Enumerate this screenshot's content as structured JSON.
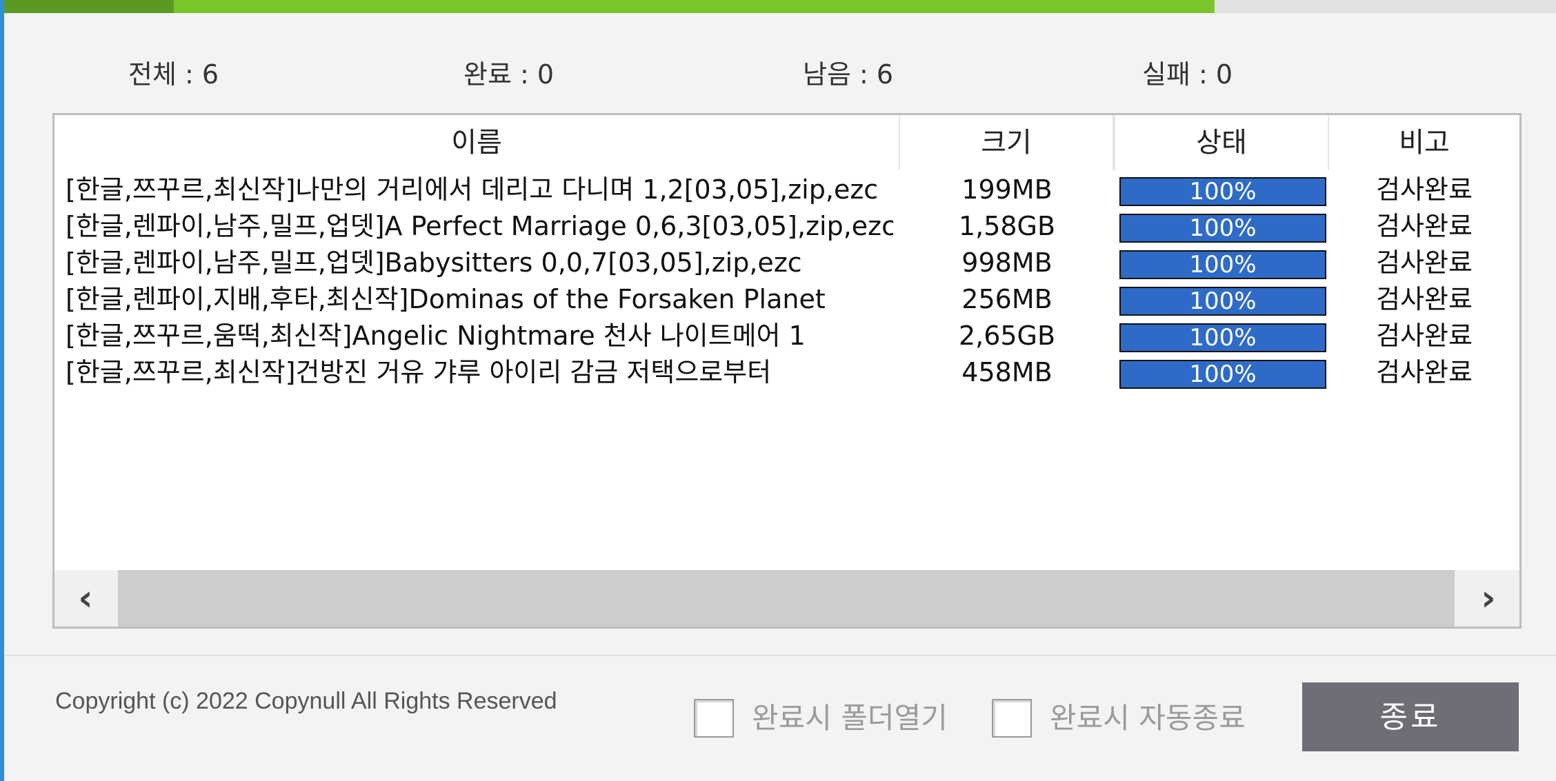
{
  "progress": {
    "overall_fraction": 0.78
  },
  "stats": [
    {
      "label": "전체 : 6"
    },
    {
      "label": "완료 : 0"
    },
    {
      "label": "남음 : 6"
    },
    {
      "label": "실패 : 0"
    }
  ],
  "table": {
    "columns": [
      "이름",
      "크기",
      "상태",
      "비고"
    ],
    "rows": [
      {
        "name": "[한글,쯔꾸르,최신작]나만의 거리에서 데리고 다니며 1,2[03,05],zip,ezc",
        "size": "199MB",
        "progress": 100,
        "status": "100%",
        "note": "검사완료"
      },
      {
        "name": "[한글,렌파이,남주,밀프,업뎃]A Perfect Marriage 0,6,3[03,05],zip,ezc",
        "size": "1,58GB",
        "progress": 100,
        "status": "100%",
        "note": "검사완료"
      },
      {
        "name": "[한글,렌파이,남주,밀프,업뎃]Babysitters 0,0,7[03,05],zip,ezc",
        "size": "998MB",
        "progress": 100,
        "status": "100%",
        "note": "검사완료"
      },
      {
        "name": "[한글,렌파이,지배,후타,최신작]Dominas of the Forsaken Planet",
        "size": "256MB",
        "progress": 100,
        "status": "100%",
        "note": "검사완료"
      },
      {
        "name": "[한글,쯔꾸르,움떡,최신작]Angelic Nightmare 천사 나이트메어 1",
        "size": "2,65GB",
        "progress": 100,
        "status": "100%",
        "note": "검사완료"
      },
      {
        "name": "[한글,쯔꾸르,최신작]건방진 거유 갸루 아이리 감금 저택으로부터",
        "size": "458MB",
        "progress": 100,
        "status": "100%",
        "note": "검사완료"
      }
    ]
  },
  "scroll": {
    "left_icon": "chevron-left-icon",
    "right_icon": "chevron-right-icon"
  },
  "footer": {
    "copyright": "Copyright (c) 2022 Copynull All Rights Reserved",
    "open_folder_label": "완료시 폴더열기",
    "auto_close_label": "완료시 자동종료",
    "close_button": "종료"
  },
  "colors": {
    "accent": "#7ac52a",
    "progress_fill": "#2e6bc8",
    "button": "#6e6e76"
  }
}
